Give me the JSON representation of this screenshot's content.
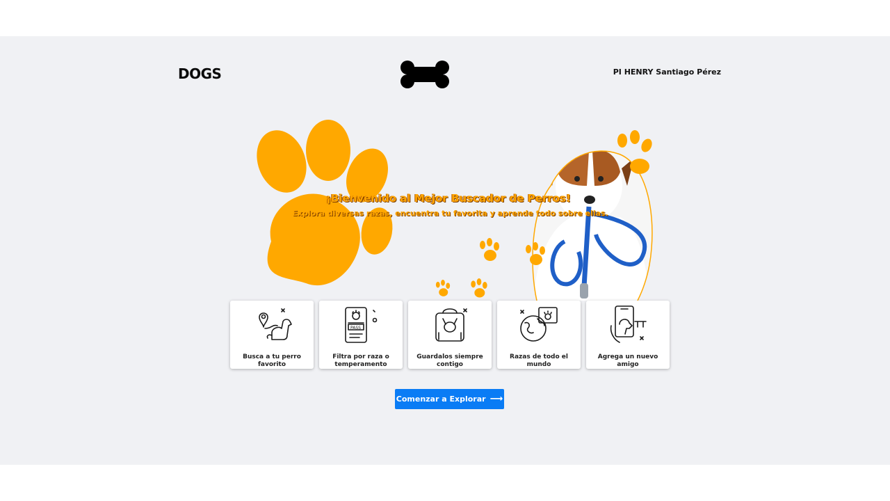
{
  "header": {
    "brand": "DOGS",
    "logo_icon": "bone-icon",
    "author": "PI HENRY Santiago Pérez"
  },
  "hero": {
    "title": "¡Bienvenido al Mejor Buscador de Perros!",
    "subtitle": "Explora diversas razas, encuentra tu favorita y aprende todo sobre ellas.",
    "accent_color": "#ffa500"
  },
  "features": [
    {
      "label": "Busca a tu perro favorito",
      "icon": "dog-location-icon"
    },
    {
      "label": "Filtra por raza o temperamento",
      "icon": "pet-passport-icon"
    },
    {
      "label": "Guardalos siempre contigo",
      "icon": "pet-backpack-icon"
    },
    {
      "label": "Razas de todo el mundo",
      "icon": "globe-paw-icon"
    },
    {
      "label": "Agrega un nuevo amigo",
      "icon": "phone-dog-icon"
    }
  ],
  "cta": {
    "label": "Comenzar a Explorar",
    "arrow": "⟶",
    "color": "#0a7cf5"
  }
}
